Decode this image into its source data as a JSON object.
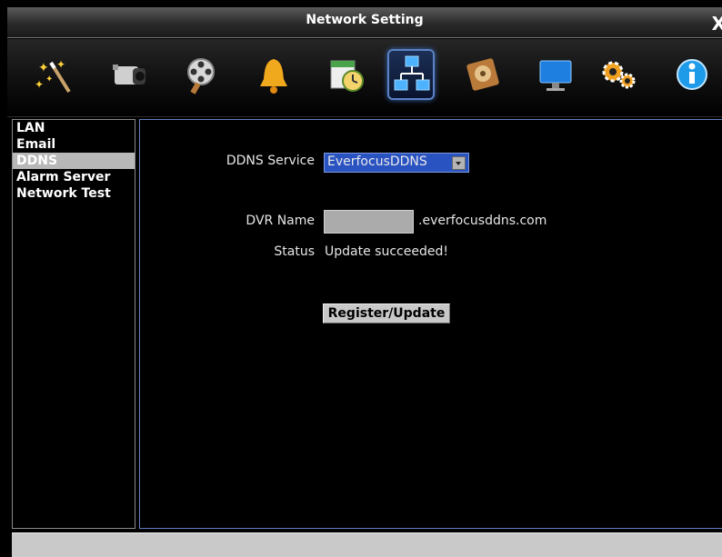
{
  "window": {
    "title": "Network Setting",
    "close_glyph": "X"
  },
  "toolbar": {
    "icons": [
      "wizard-icon",
      "camera-icon",
      "record-icon",
      "alarm-bell-icon",
      "schedule-icon",
      "network-icon",
      "disk-icon",
      "monitor-icon",
      "system-gears-icon",
      "info-icon"
    ],
    "selected": "network-icon"
  },
  "sidebar": {
    "items": [
      {
        "label": "LAN"
      },
      {
        "label": "Email"
      },
      {
        "label": "DDNS"
      },
      {
        "label": "Alarm Server"
      },
      {
        "label": "Network Test"
      }
    ],
    "active": "DDNS"
  },
  "form": {
    "ddns_service_label": "DDNS Service",
    "ddns_service_value": "EverfocusDDNS",
    "dvr_name_label": "DVR Name",
    "dvr_name_value": "",
    "domain_suffix": ".everfocusddns.com",
    "status_label": "Status",
    "status_value": "Update succeeded!",
    "register_button": "Register/Update"
  },
  "colors": {
    "accent": "#2a53c2",
    "selection": "#b8b8b8",
    "border": "#5f7ec0"
  }
}
